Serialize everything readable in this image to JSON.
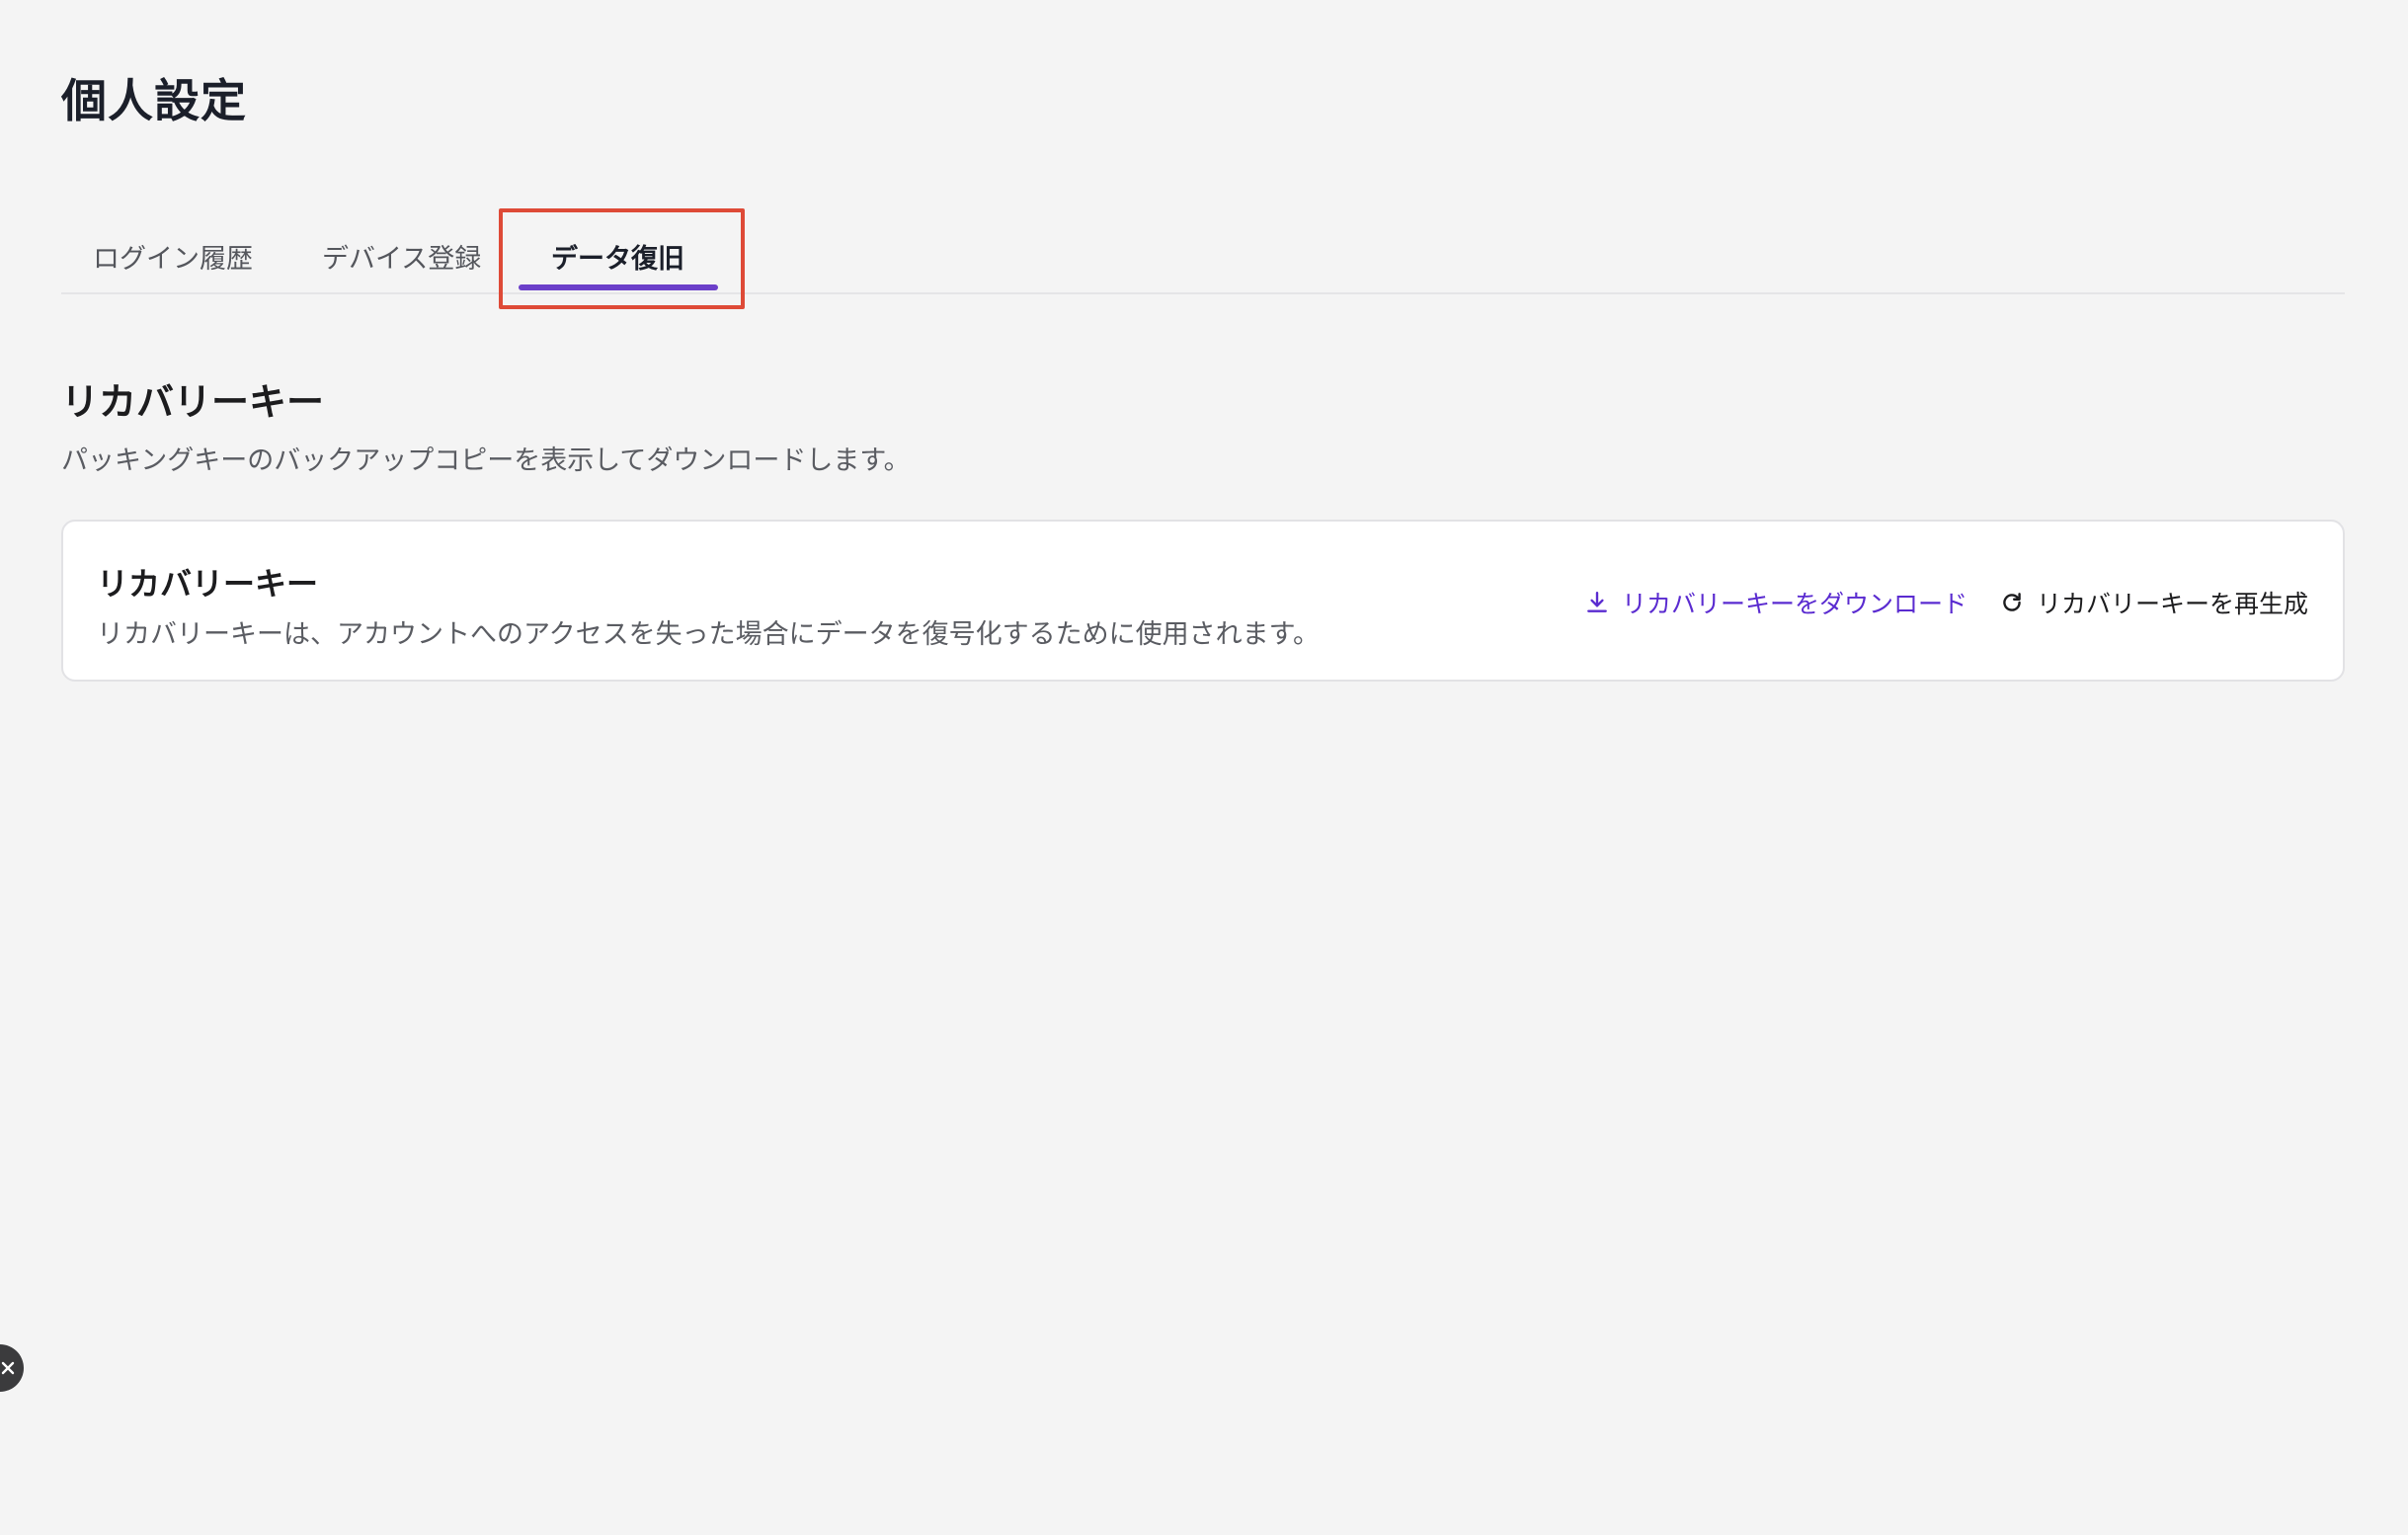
{
  "page": {
    "title": "個人設定"
  },
  "tabs": [
    {
      "label": "ログイン履歴"
    },
    {
      "label": "デバイス登録"
    },
    {
      "label": "データ復旧",
      "active": true
    }
  ],
  "section": {
    "title": "リカバリーキー",
    "description": "パッキングキーのバックアップコピーを表示してダウンロードします。"
  },
  "card": {
    "title": "リカバリーキー",
    "description": "リカバリーキーは、アカウントへのアクセスを失った場合にデータを復号化するために使用されます。",
    "download_label": "リカバリーキーをダウンロード",
    "download_icon": "download-icon",
    "regenerate_label": "リカバリーキーを再生成",
    "regenerate_icon": "refresh-icon"
  },
  "colors": {
    "accent": "#6b3fc9",
    "link": "#5a2bd0",
    "highlight": "#de4a37",
    "background": "#f4f4f4"
  }
}
